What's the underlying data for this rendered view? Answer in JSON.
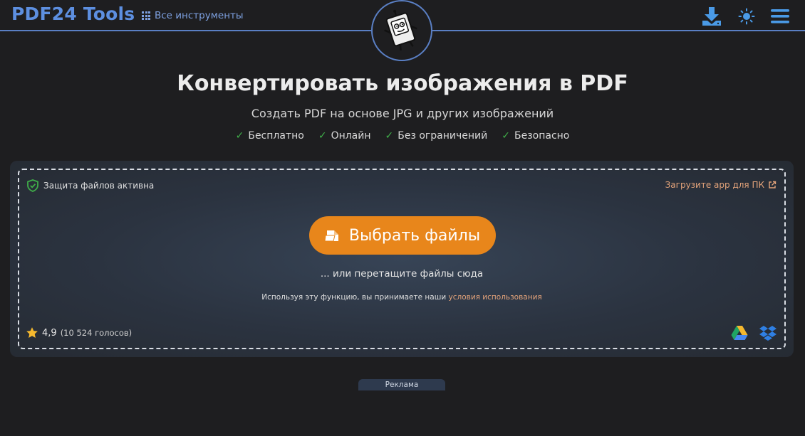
{
  "header": {
    "logo": "PDF24 Tools",
    "all_tools_label": "Все инструменты",
    "icons": [
      "download-icon",
      "theme-toggle-icon",
      "menu-icon"
    ],
    "brand_color": "#5d8fe0"
  },
  "hero": {
    "title": "Конвертировать изображения в PDF",
    "subtitle": "Создать PDF на основе JPG и других изображений",
    "features": [
      "Бесплатно",
      "Онлайн",
      "Без ограничений",
      "Безопасно"
    ],
    "check_mark": "✓"
  },
  "dropzone": {
    "protection_label": "Защита файлов активна",
    "app_link": "Загрузите арр для ПК",
    "choose_button": "Выбрать файлы",
    "or_drag": "... или перетащите файлы сюда",
    "terms_prefix": "Используя эту функцию, вы принимаете наши",
    "terms_link": "условия использования",
    "rating_value": "4,9",
    "rating_votes": "(10 524 голосов)",
    "cloud_icons": [
      "google-drive-icon",
      "dropbox-icon"
    ],
    "button_color": "#e8861b"
  },
  "ad": {
    "label": "Реклама"
  }
}
